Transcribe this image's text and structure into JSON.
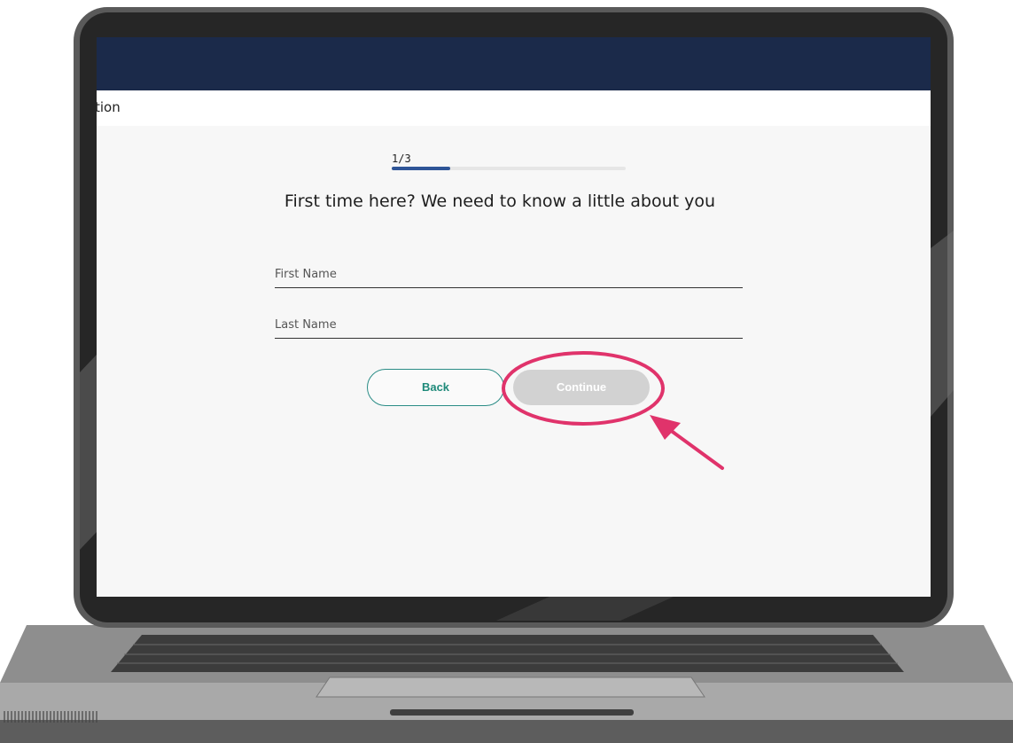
{
  "header": {
    "partial_title": "tion"
  },
  "step": {
    "label": "1/3",
    "progress": 0.25
  },
  "form": {
    "heading": "First time here? We need to know a little about you",
    "first_name_label": "First Name",
    "last_name_label": "Last Name"
  },
  "buttons": {
    "back_label": "Back",
    "continue_label": "Continue"
  },
  "colors": {
    "topbar": "#1b2a4a",
    "progress": "#2f5597",
    "back_border": "#2a8c86",
    "continue_disabled": "#d2d2d2",
    "annotation": "#e0336b"
  },
  "annotation": {
    "type": "highlight-circle-and-arrow",
    "target": "continue-button"
  }
}
